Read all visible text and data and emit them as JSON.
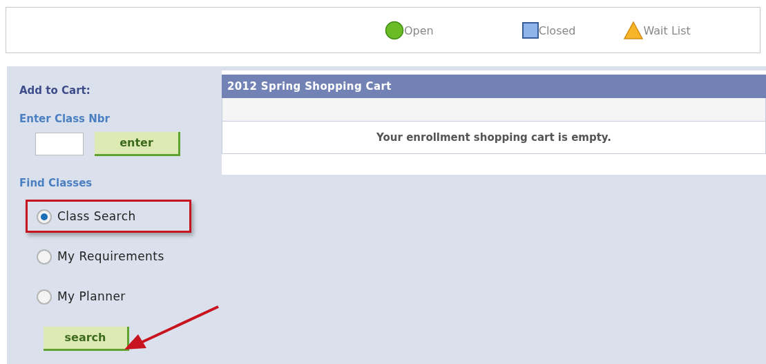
{
  "legend": [
    {
      "kind": "circle",
      "label": "Open"
    },
    {
      "kind": "square",
      "label": "Closed"
    },
    {
      "kind": "triangle",
      "label": "Wait List"
    }
  ],
  "add_to_cart": {
    "title": "Add to Cart:",
    "class_nbr_label": "Enter Class Nbr",
    "enter_button": "enter"
  },
  "find_classes": {
    "title": "Find Classes",
    "options": [
      {
        "label": "Class Search",
        "selected": true
      },
      {
        "label": "My Requirements",
        "selected": false
      },
      {
        "label": "My Planner",
        "selected": false
      }
    ],
    "search_button": "search"
  },
  "cart": {
    "title": "2012 Spring Shopping Cart",
    "message": "Your enrollment shopping cart is empty."
  }
}
